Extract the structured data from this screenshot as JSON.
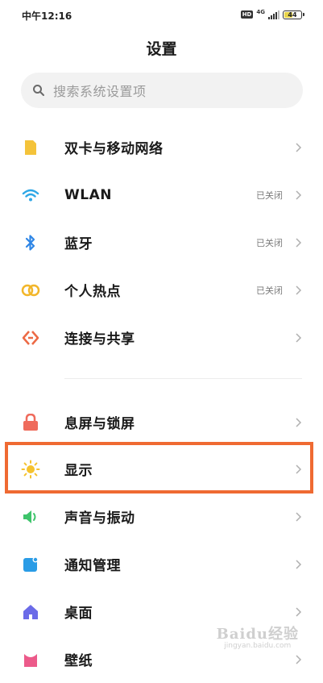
{
  "status_bar": {
    "time": "中午12:16",
    "hd": "HD",
    "network": "4G",
    "battery": "44",
    "battery_level": 0.44
  },
  "page_title": "设置",
  "search": {
    "placeholder": "搜索系统设置项"
  },
  "items": [
    {
      "label": "双卡与移动网络",
      "status": "",
      "icon": "sim-card-icon",
      "color": "#f4c33a"
    },
    {
      "label": "WLAN",
      "status": "已关闭",
      "icon": "wifi-icon",
      "color": "#2fa7e6"
    },
    {
      "label": "蓝牙",
      "status": "已关闭",
      "icon": "bluetooth-icon",
      "color": "#2f86e6"
    },
    {
      "label": "个人热点",
      "status": "已关闭",
      "icon": "hotspot-icon",
      "color": "#f2b62a"
    },
    {
      "label": "连接与共享",
      "status": "",
      "icon": "share-icon",
      "color": "#ec6a45"
    },
    {
      "label": "息屏与锁屏",
      "status": "",
      "icon": "lock-icon",
      "color": "#ef6b5c"
    },
    {
      "label": "显示",
      "status": "",
      "icon": "sun-icon",
      "color": "#f5c22e"
    },
    {
      "label": "声音与振动",
      "status": "",
      "icon": "speaker-icon",
      "color": "#3ec46b"
    },
    {
      "label": "通知管理",
      "status": "",
      "icon": "notification-icon",
      "color": "#2a9ce6"
    },
    {
      "label": "桌面",
      "status": "",
      "icon": "home-icon",
      "color": "#6b6be8"
    },
    {
      "label": "壁纸",
      "status": "",
      "icon": "wallpaper-icon",
      "color": "#ec5a8a"
    }
  ],
  "highlight": {
    "color": "#ef6a32",
    "target": "显示"
  },
  "watermark": {
    "text": "Baidu经验",
    "sub": "jingyan.baidu.com"
  }
}
